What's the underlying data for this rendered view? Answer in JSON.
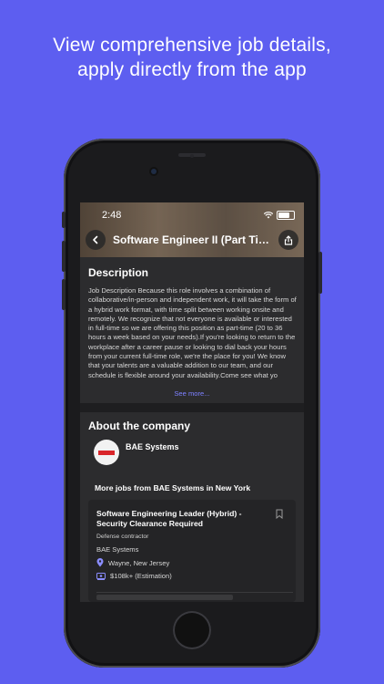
{
  "headline": {
    "line1": "View comprehensive job details,",
    "line2": "apply directly from the app"
  },
  "status_bar": {
    "time": "2:48"
  },
  "header": {
    "title": "Software Engineer II (Part Time...",
    "back_icon": "chevron-left-icon",
    "share_icon": "share-icon"
  },
  "description": {
    "heading": "Description",
    "body": "Job Description Because this role involves a combination of collaborative/in-person and independent work, it will take the form of a hybrid work format, with time split between working onsite and remotely. We recognize that not everyone is available or interested in full-time so we are offering this position as part-time (20 to 36 hours a week based on your needs).If you're looking to return to the workplace after a career pause or looking to dial back your hours from your current full-time role, we're the place for you! We know that your talents are a valuable addition to our team, and our schedule is flexible around your availability.Come see what yo",
    "see_more": "See more..."
  },
  "about": {
    "heading": "About the company",
    "company_name": "BAE Systems",
    "more_jobs_label": "More jobs from BAE Systems in New York"
  },
  "job_card": {
    "title": "Software Engineering Leader (Hybrid) - Security Clearance Required",
    "sector": "Defense contractor",
    "company": "BAE Systems",
    "location": "Wayne, New Jersey",
    "salary": "$108k+ (Estimation)"
  },
  "colors": {
    "background": "#5d5ef0",
    "accent": "#7d80ff",
    "card": "#2c2c2e"
  }
}
